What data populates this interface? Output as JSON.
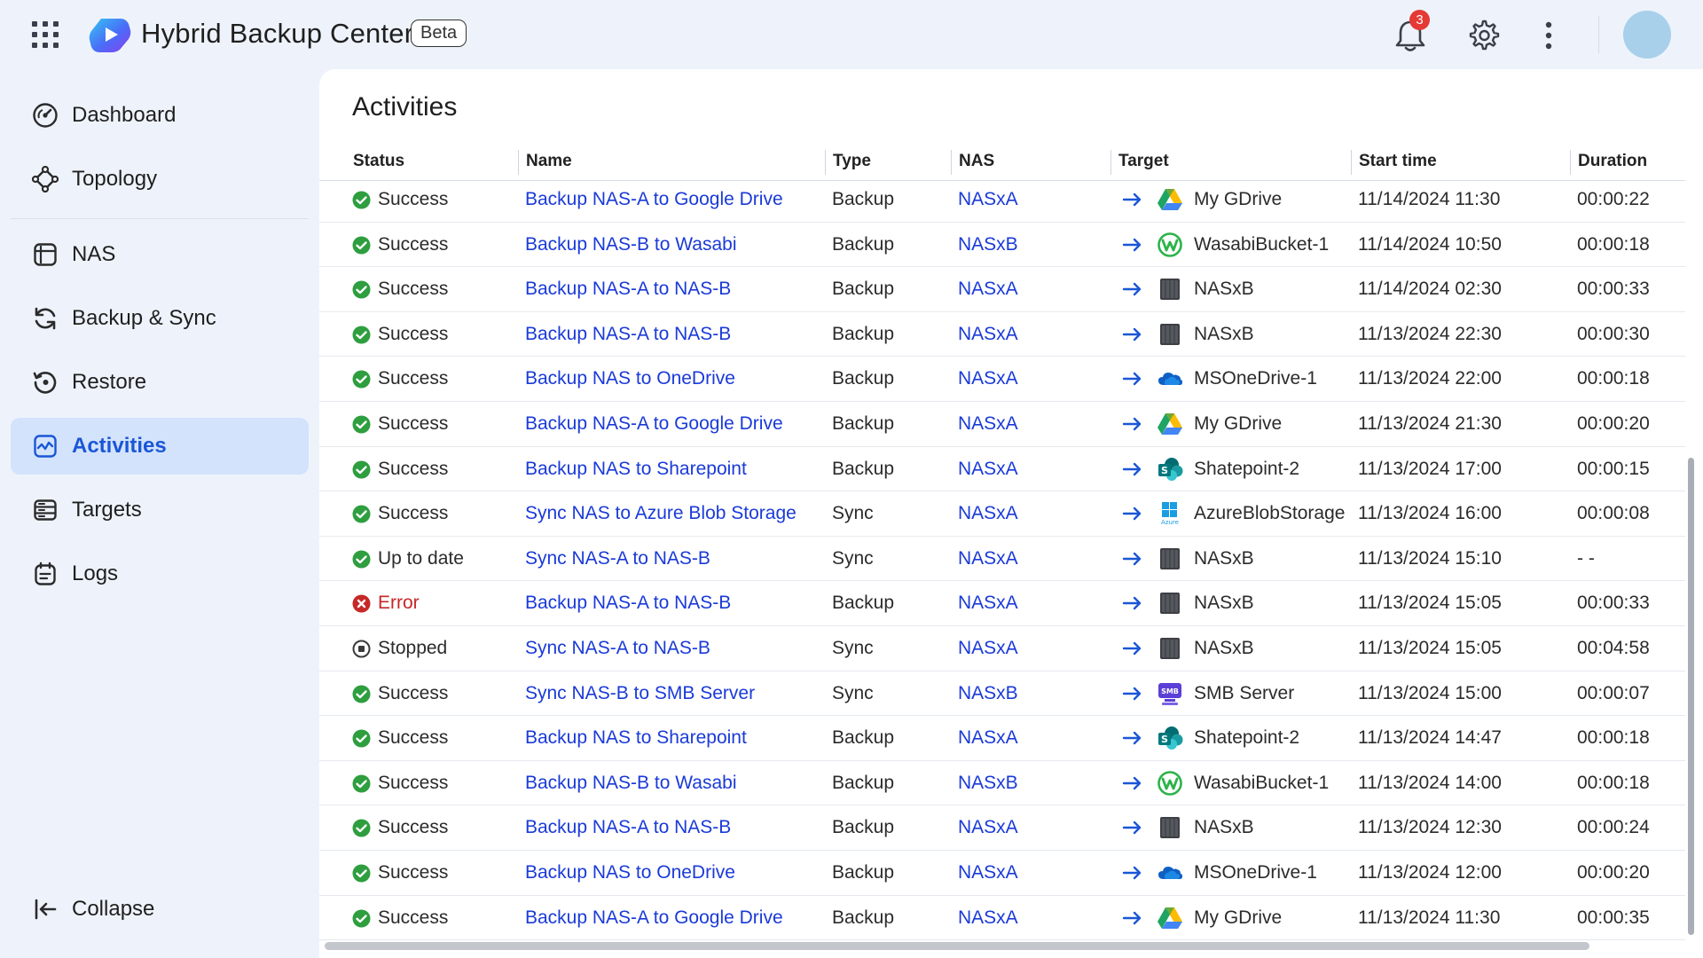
{
  "app": {
    "title": "Hybrid Backup Center",
    "badge": "Beta",
    "notification_count": "3",
    "accent": "#1a56d6"
  },
  "sidebar": {
    "items": [
      {
        "label": "Dashboard",
        "icon": "dashboard-icon"
      },
      {
        "label": "Topology",
        "icon": "topology-icon"
      },
      {
        "label": "NAS",
        "icon": "nas-icon"
      },
      {
        "label": "Backup & Sync",
        "icon": "sync-icon"
      },
      {
        "label": "Restore",
        "icon": "restore-icon"
      },
      {
        "label": "Activities",
        "icon": "activities-icon",
        "active": true
      },
      {
        "label": "Targets",
        "icon": "targets-icon"
      },
      {
        "label": "Logs",
        "icon": "logs-icon"
      }
    ],
    "collapse_label": "Collapse"
  },
  "main": {
    "title": "Activities",
    "columns": [
      "Status",
      "Name",
      "Type",
      "NAS",
      "Target",
      "Start time",
      "Duration"
    ],
    "rows": [
      {
        "status": "Success",
        "name": "Backup NAS-A to Google Drive",
        "type": "Backup",
        "nas": "NASxA",
        "target_icon": "gdrive",
        "target": "My GDrive",
        "start": "11/14/2024 11:30",
        "duration": "00:00:22"
      },
      {
        "status": "Success",
        "name": "Backup NAS-B to Wasabi",
        "type": "Backup",
        "nas": "NASxB",
        "target_icon": "wasabi",
        "target": "WasabiBucket-1",
        "start": "11/14/2024 10:50",
        "duration": "00:00:18"
      },
      {
        "status": "Success",
        "name": "Backup NAS-A to NAS-B",
        "type": "Backup",
        "nas": "NASxA",
        "target_icon": "nas",
        "target": "NASxB",
        "start": "11/14/2024 02:30",
        "duration": "00:00:33"
      },
      {
        "status": "Success",
        "name": "Backup NAS-A to NAS-B",
        "type": "Backup",
        "nas": "NASxA",
        "target_icon": "nas",
        "target": "NASxB",
        "start": "11/13/2024 22:30",
        "duration": "00:00:30"
      },
      {
        "status": "Success",
        "name": "Backup NAS to OneDrive",
        "type": "Backup",
        "nas": "NASxA",
        "target_icon": "onedrive",
        "target": "MSOneDrive-1",
        "start": "11/13/2024 22:00",
        "duration": "00:00:18"
      },
      {
        "status": "Success",
        "name": "Backup NAS-A to Google Drive",
        "type": "Backup",
        "nas": "NASxA",
        "target_icon": "gdrive",
        "target": "My GDrive",
        "start": "11/13/2024 21:30",
        "duration": "00:00:20"
      },
      {
        "status": "Success",
        "name": "Backup NAS to Sharepoint",
        "type": "Backup",
        "nas": "NASxA",
        "target_icon": "sharepoint",
        "target": "Shatepoint-2",
        "start": "11/13/2024 17:00",
        "duration": "00:00:15"
      },
      {
        "status": "Success",
        "name": "Sync NAS to Azure Blob Storage",
        "type": "Sync",
        "nas": "NASxA",
        "target_icon": "azure",
        "target": "AzureBlobStorage",
        "start": "11/13/2024 16:00",
        "duration": "00:00:08"
      },
      {
        "status": "Up to date",
        "name": "Sync NAS-A to NAS-B",
        "type": "Sync",
        "nas": "NASxA",
        "target_icon": "nas",
        "target": "NASxB",
        "start": "11/13/2024 15:10",
        "duration": "- -"
      },
      {
        "status": "Error",
        "name": "Backup NAS-A to NAS-B",
        "type": "Backup",
        "nas": "NASxA",
        "target_icon": "nas",
        "target": "NASxB",
        "start": "11/13/2024 15:05",
        "duration": "00:00:33"
      },
      {
        "status": "Stopped",
        "name": "Sync NAS-A to NAS-B",
        "type": "Sync",
        "nas": "NASxA",
        "target_icon": "nas",
        "target": "NASxB",
        "start": "11/13/2024 15:05",
        "duration": "00:04:58"
      },
      {
        "status": "Success",
        "name": "Sync NAS-B to SMB Server",
        "type": "Sync",
        "nas": "NASxB",
        "target_icon": "smb",
        "target": "SMB Server",
        "start": "11/13/2024 15:00",
        "duration": "00:00:07"
      },
      {
        "status": "Success",
        "name": "Backup NAS to Sharepoint",
        "type": "Backup",
        "nas": "NASxA",
        "target_icon": "sharepoint",
        "target": "Shatepoint-2",
        "start": "11/13/2024 14:47",
        "duration": "00:00:18"
      },
      {
        "status": "Success",
        "name": "Backup NAS-B to Wasabi",
        "type": "Backup",
        "nas": "NASxB",
        "target_icon": "wasabi",
        "target": "WasabiBucket-1",
        "start": "11/13/2024 14:00",
        "duration": "00:00:18"
      },
      {
        "status": "Success",
        "name": "Backup NAS-A to NAS-B",
        "type": "Backup",
        "nas": "NASxA",
        "target_icon": "nas",
        "target": "NASxB",
        "start": "11/13/2024 12:30",
        "duration": "00:00:24"
      },
      {
        "status": "Success",
        "name": "Backup NAS to OneDrive",
        "type": "Backup",
        "nas": "NASxA",
        "target_icon": "onedrive",
        "target": "MSOneDrive-1",
        "start": "11/13/2024 12:00",
        "duration": "00:00:20"
      },
      {
        "status": "Success",
        "name": "Backup NAS-A to Google Drive",
        "type": "Backup",
        "nas": "NASxA",
        "target_icon": "gdrive",
        "target": "My GDrive",
        "start": "11/13/2024 11:30",
        "duration": "00:00:35"
      }
    ]
  },
  "colors": {
    "success": "#2e9e3f",
    "error": "#c62828",
    "link": "#1a3ad8",
    "arrow": "#1a56d6"
  }
}
